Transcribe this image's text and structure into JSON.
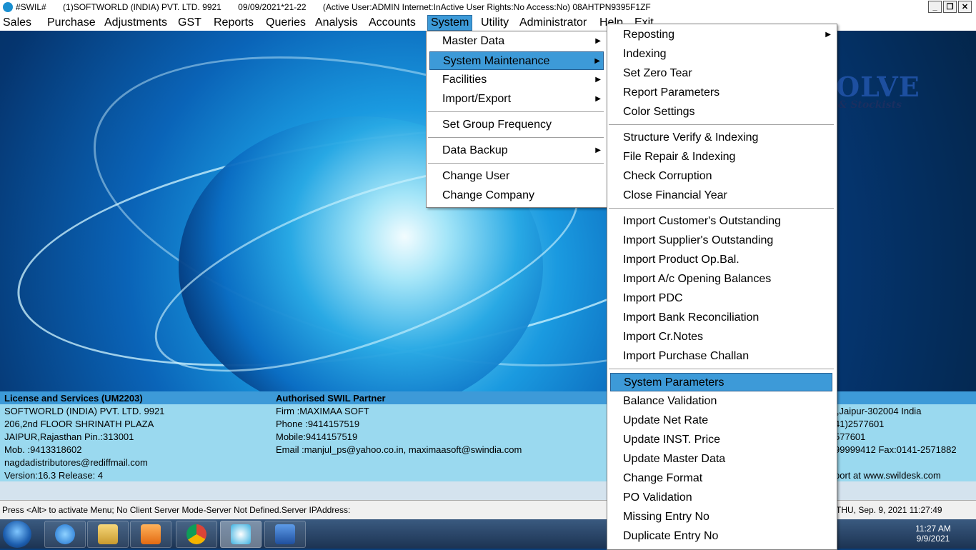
{
  "titlebar": {
    "text": "#SWIL#       (1)SOFTWORLD (INDIA) PVT. LTD. 9921       09/09/2021*21-22       (Active User:ADMIN Internet:InActive User Rights:No Access:No) 08AHTPN9395F1ZF",
    "minimize": "_",
    "restore": "❐",
    "close": "✕"
  },
  "menubar": {
    "items": [
      "Sales",
      "Purchase",
      "Adjustments",
      "GST",
      "Reports",
      "Queries",
      "Analysis",
      "Accounts",
      "System",
      "Utility",
      "Administrator",
      "Help",
      "Exit"
    ],
    "active": "System"
  },
  "system_menu": {
    "items": [
      {
        "label": "Master Data",
        "submenu": true
      },
      {
        "label": "System Maintenance",
        "submenu": true,
        "highlighted": true
      },
      {
        "label": "Facilities",
        "submenu": true
      },
      {
        "label": "Import/Export",
        "submenu": true
      },
      {
        "label": "Set Group Frequency",
        "submenu": false
      },
      {
        "label": "Data Backup",
        "submenu": true
      },
      {
        "label": "Change User",
        "submenu": false
      },
      {
        "label": "Change Company",
        "submenu": false
      }
    ]
  },
  "maintenance_menu": {
    "items": [
      {
        "label": "Reposting",
        "submenu": true
      },
      {
        "label": "Indexing"
      },
      {
        "label": "Set Zero Tear"
      },
      {
        "label": "Report Parameters"
      },
      {
        "label": "Color Settings"
      },
      {
        "label": "Structure Verify & Indexing"
      },
      {
        "label": "File Repair & Indexing"
      },
      {
        "label": "Check Corruption"
      },
      {
        "label": "Close Financial Year"
      },
      {
        "label": "Import Customer's Outstanding"
      },
      {
        "label": "Import Supplier's Outstanding"
      },
      {
        "label": "Import Product Op.Bal."
      },
      {
        "label": "Import A/c Opening Balances"
      },
      {
        "label": "Import PDC"
      },
      {
        "label": "Import Bank Reconciliation"
      },
      {
        "label": "Import Cr.Notes"
      },
      {
        "label": "Import Purchase Challan"
      },
      {
        "label": "System Parameters",
        "highlighted": true
      },
      {
        "label": "Balance Validation"
      },
      {
        "label": "Update Net Rate"
      },
      {
        "label": "Update INST. Price"
      },
      {
        "label": "Update Master Data"
      },
      {
        "label": "Change Format"
      },
      {
        "label": "PO Validation"
      },
      {
        "label": "Missing Entry No"
      },
      {
        "label": "Duplicate Entry No"
      }
    ]
  },
  "logo": {
    "text": "OLVE",
    "subtitle": "s & Stockists"
  },
  "license": {
    "heading": "License and Services (UM2203)",
    "lines": [
      "SOFTWORLD (INDIA) PVT. LTD. 9921",
      "206,2nd FLOOR SHRINATH PLAZA",
      "JAIPUR,Rajasthan Pin.:313001",
      "Mob. :9413318602",
      "nagdadistributores@rediffmail.com",
      "Version:16.3 Release: 4"
    ]
  },
  "partner": {
    "heading": "Authorised SWIL Partner",
    "lines": [
      "Firm  :MAXIMAA SOFT",
      "Phone :9414157519",
      "Mobile:9414157519",
      "Email :manjul_ps@yahoo.co.in, maximaasoft@swindia.com"
    ]
  },
  "right_info": {
    "lines": [
      "l,Jaipur-302004 India",
      "41)2577601",
      "577601",
      "99999412 Fax:0141-2571882",
      "",
      "port at www.swildesk.com"
    ]
  },
  "status": {
    "message": "Press <Alt> to activate Menu; No Client Server Mode-Server Not Defined.Server IPAddress:",
    "datetime": "THU, Sep.  9, 2021  11:27:49"
  },
  "taskbar": {
    "time": "11:27 AM",
    "date": "9/9/2021"
  }
}
